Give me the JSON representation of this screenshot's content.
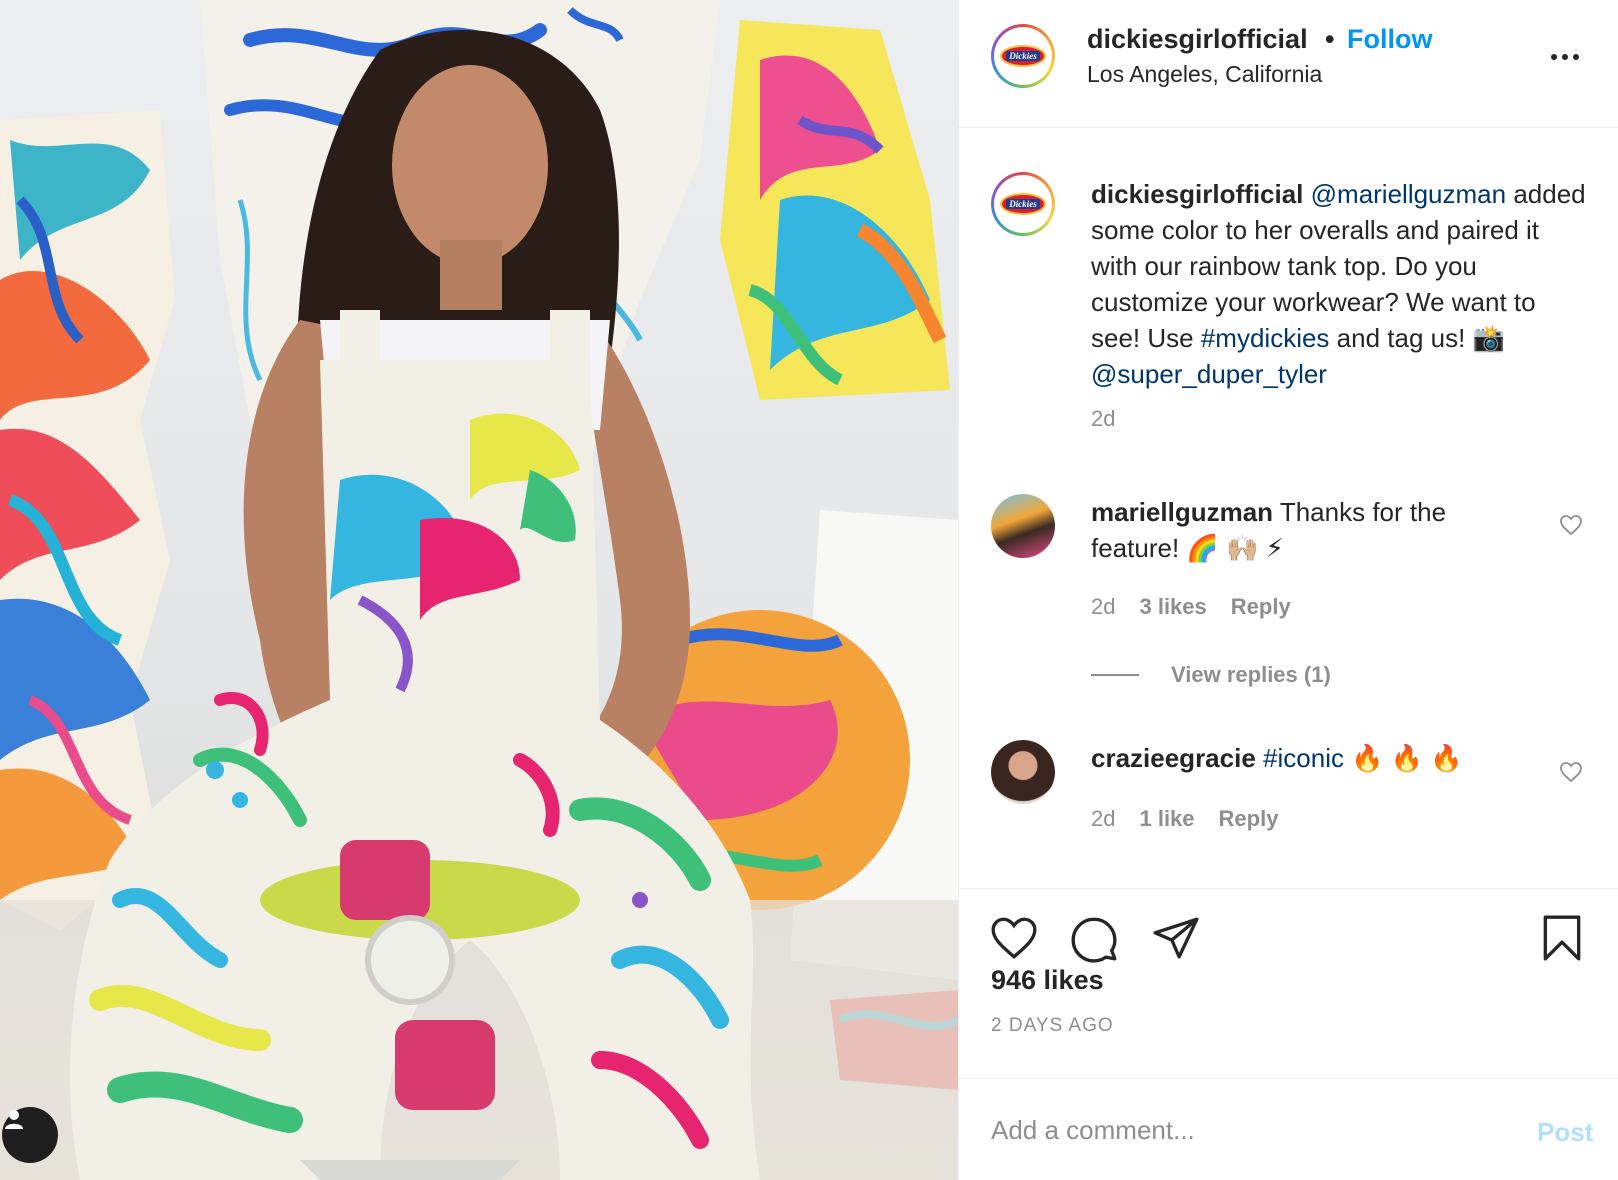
{
  "post": {
    "photo_alt": "",
    "header": {
      "username": "dickiesgirlofficial",
      "separator": "•",
      "follow_label": "Follow",
      "location": "Los Angeles, California",
      "logo_text": "Dickies"
    },
    "caption": {
      "username": "dickiesgirlofficial",
      "mention": "@mariellguzman",
      "text_1": "added some color to her overalls and paired it with our rainbow tank top. Do you customize your workwear? We want to see! Use",
      "hashtag": "#mydickies",
      "text_2": "and tag us!",
      "emoji": "📸",
      "credit": "@super_duper_tyler",
      "time": "2d"
    },
    "comments": [
      {
        "username": "mariellguzman",
        "text": "Thanks for the feature!",
        "emoji": "🌈 🙌🏼 ⚡",
        "time": "2d",
        "likes": "3 likes",
        "reply_label": "Reply",
        "view_replies": "View replies (1)"
      },
      {
        "username": "crazieegracie",
        "hashtag": "#iconic",
        "emoji": "🔥 🔥 🔥",
        "time": "2d",
        "likes": "1 like",
        "reply_label": "Reply"
      }
    ],
    "actions": {
      "icons": [
        "heart-icon",
        "comment-icon",
        "share-icon",
        "bookmark-icon"
      ],
      "likes": "946 likes",
      "time_ago": "2 DAYS AGO"
    },
    "add_comment": {
      "placeholder": "Add a comment...",
      "value": "",
      "post_label": "Post"
    },
    "colors": {
      "link_blue": "#00376b",
      "follow_blue": "#0095f6",
      "post_disabled": "#b2dffc",
      "meta_gray": "#8e8e8e",
      "text": "#262626"
    }
  }
}
